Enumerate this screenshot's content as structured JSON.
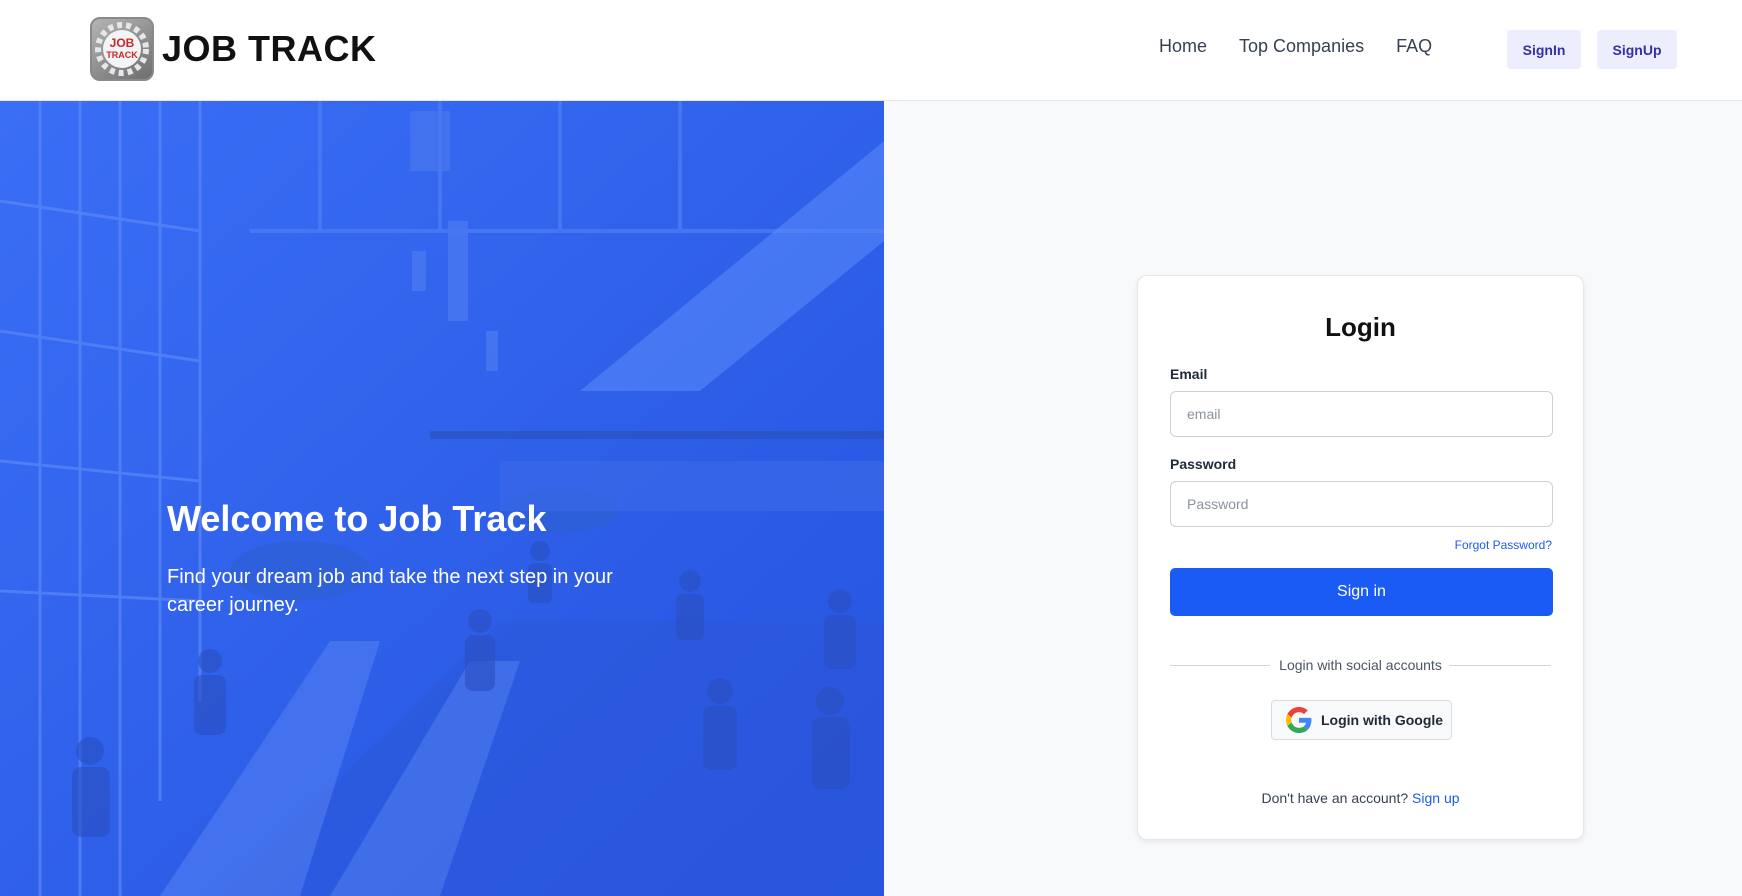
{
  "header": {
    "brand": "JOB TRACK",
    "logo_text_top": "JOB",
    "logo_text_bottom": "TRACK",
    "nav": [
      {
        "label": "Home"
      },
      {
        "label": "Top Companies"
      },
      {
        "label": "FAQ"
      }
    ],
    "signin_label": "SignIn",
    "signup_label": "SignUp"
  },
  "hero": {
    "title": "Welcome to Job Track",
    "subtitle": "Find your dream job and take the next step in your career journey."
  },
  "login": {
    "title": "Login",
    "email_label": "Email",
    "email_placeholder": "email",
    "password_label": "Password",
    "password_placeholder": "Password",
    "forgot_label": "Forgot Password?",
    "submit_label": "Sign in",
    "social_divider": "Login with social accounts",
    "google_label": "Login with Google",
    "no_account_text": "Don't have an account?",
    "signup_link": "Sign up"
  },
  "colors": {
    "primary": "#1a5bf6",
    "hero_overlay": "#2f63f0",
    "header_button_bg": "#eceefe",
    "header_button_text": "#3730a3"
  },
  "icons": {
    "google": "google-icon"
  }
}
